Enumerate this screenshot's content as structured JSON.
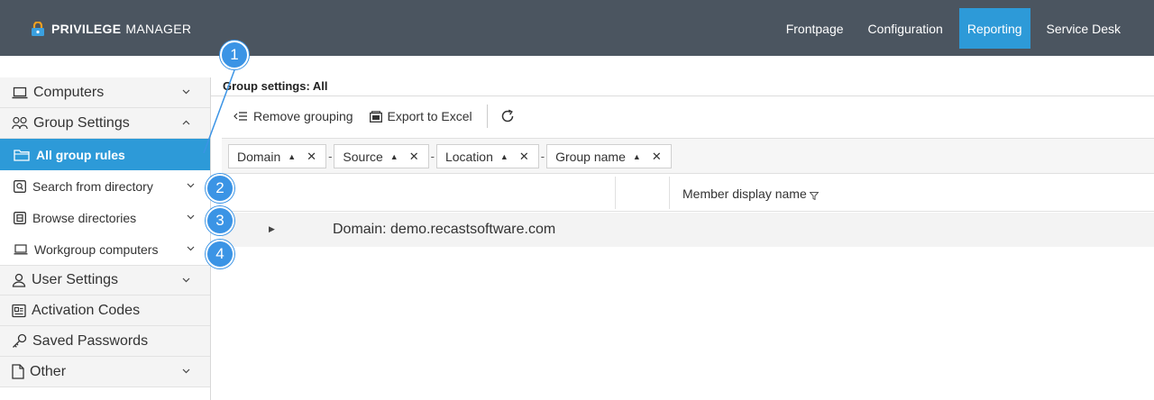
{
  "app": {
    "brand_bold": "PRIVILEGE",
    "brand_thin": "MANAGER",
    "accent": "#2d9ad8",
    "topbar_color": "#4b5560"
  },
  "nav": [
    {
      "label": "Frontpage",
      "active": false
    },
    {
      "label": "Configuration",
      "active": false
    },
    {
      "label": "Reporting",
      "active": true
    },
    {
      "label": "Service Desk",
      "active": false
    }
  ],
  "sidebar": {
    "computers": "Computers",
    "group_settings": "Group Settings",
    "all_group_rules": "All group rules",
    "search_from_directory": "Search from directory",
    "browse_directories": "Browse directories",
    "workgroup_computers": "Workgroup computers",
    "user_settings": "User Settings",
    "activation_codes": "Activation Codes",
    "saved_passwords": "Saved Passwords",
    "other": "Other"
  },
  "main": {
    "title": "Group settings: All",
    "toolbar": {
      "remove_grouping": "Remove grouping",
      "export_excel": "Export to Excel"
    },
    "group_chips": [
      {
        "label": "Domain"
      },
      {
        "label": "Source"
      },
      {
        "label": "Location"
      },
      {
        "label": "Group name"
      }
    ],
    "sort_glyph": "▲",
    "remove_glyph": "✕",
    "chip_separator": "-",
    "column_header": "Member display name",
    "group_row": "Domain: demo.recastsoftware.com"
  },
  "callouts": [
    "1",
    "2",
    "3",
    "4"
  ]
}
